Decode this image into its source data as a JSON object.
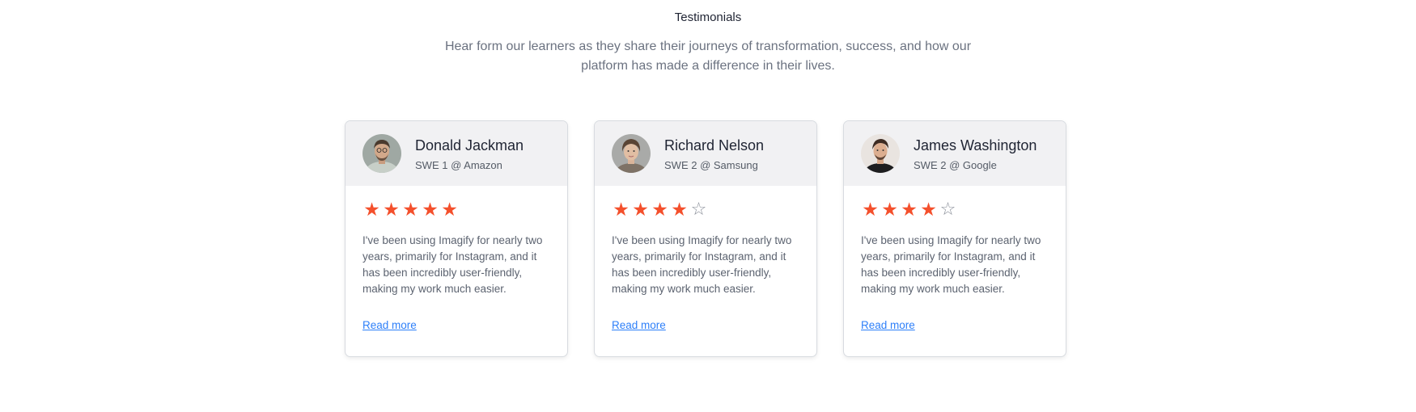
{
  "section": {
    "title": "Testimonials",
    "subtitle": "Hear form our learners as they share their journeys of transformation, success, and how our platform has made a difference in their lives."
  },
  "testimonials": [
    {
      "name": "Donald Jackman",
      "role": "SWE 1 @ Amazon",
      "rating": 5,
      "max_rating": 5,
      "text": "I've been using Imagify for nearly two years, primarily for Instagram, and it has been incredibly user-friendly, making my work much easier.",
      "link_label": "Read more"
    },
    {
      "name": "Richard Nelson",
      "role": "SWE 2 @ Samsung",
      "rating": 4,
      "max_rating": 5,
      "text": "I've been using Imagify for nearly two years, primarily for Instagram, and it has been incredibly user-friendly, making my work much easier.",
      "link_label": "Read more"
    },
    {
      "name": "James Washington",
      "role": "SWE 2 @ Google",
      "rating": 4,
      "max_rating": 5,
      "text": "I've been using Imagify for nearly two years, primarily for Instagram, and it has been incredibly user-friendly, making my work much easier.",
      "link_label": "Read more"
    }
  ],
  "colors": {
    "star_filled": "#f4502c",
    "star_empty": "#8a8f99",
    "link": "#2d7ff9",
    "card_header_bg": "#f1f1f3"
  },
  "icons": {
    "star_filled": "star-filled-icon",
    "star_empty": "star-outline-icon"
  }
}
